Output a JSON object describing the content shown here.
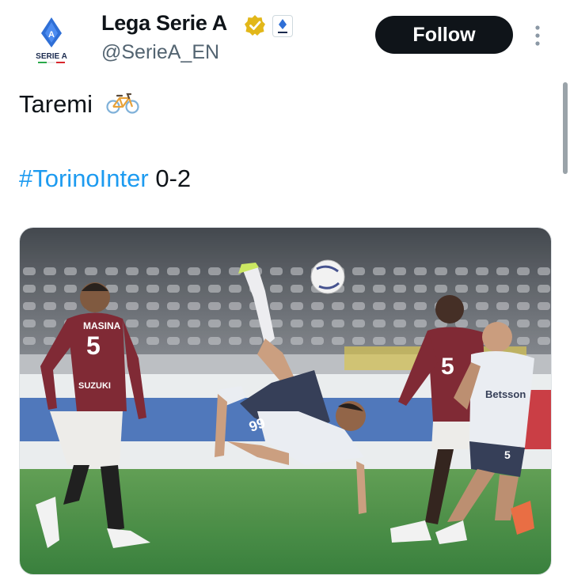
{
  "account": {
    "name": "Lega Serie A",
    "handle": "@SerieA_EN",
    "logo_text": "SERIE A",
    "verified_icon": "verified-badge-icon",
    "affiliate_icon": "affiliate-badge-icon"
  },
  "follow_label": "Follow",
  "more_icon": "more-options-icon",
  "tweet": {
    "line1": "Taremi",
    "emoji_icon": "bicycle-icon",
    "hashtag": "#TorinoInter",
    "score": " 0-2"
  },
  "media": {
    "players": [
      {
        "name": "MASINA",
        "number": "5",
        "sponsor": "SUZUKI"
      },
      {
        "number": "99"
      },
      {
        "sponsor": "Betsson"
      },
      {
        "number": "5"
      }
    ]
  },
  "colors": {
    "accent": "#1d9bf0",
    "button_bg": "#0f1419",
    "handle": "#536471",
    "torino_kit": "#7a1f2b",
    "inter_kit": "#e9edf2",
    "pitch": "#3f8a3a"
  }
}
